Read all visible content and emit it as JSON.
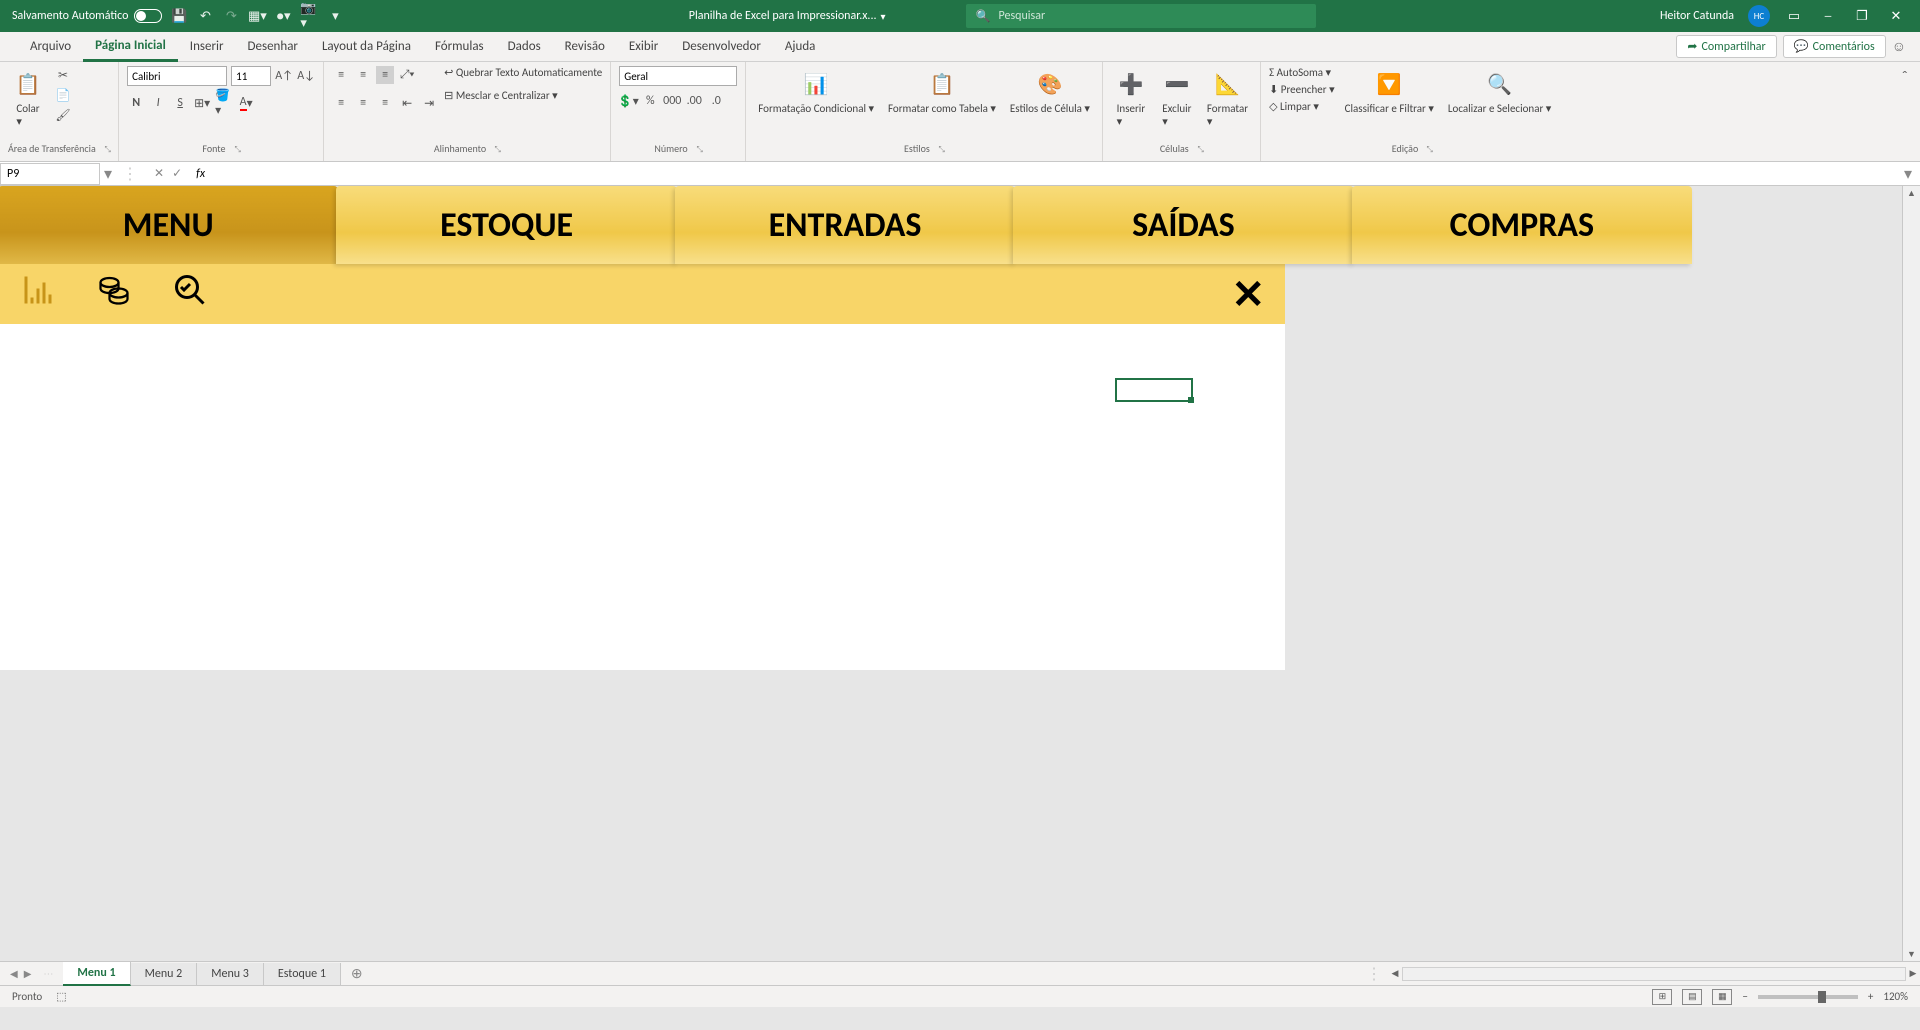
{
  "titleBar": {
    "autosave": "Salvamento Automático",
    "filename": "Planilha de Excel para Impressionar.x...",
    "searchPlaceholder": "Pesquisar",
    "username": "Heitor Catunda",
    "userInitials": "HC"
  },
  "ribbonTabs": {
    "arquivo": "Arquivo",
    "paginaInicial": "Página Inicial",
    "inserir": "Inserir",
    "desenhar": "Desenhar",
    "layout": "Layout da Página",
    "formulas": "Fórmulas",
    "dados": "Dados",
    "revisao": "Revisão",
    "exibir": "Exibir",
    "desenvolvedor": "Desenvolvedor",
    "ajuda": "Ajuda",
    "compartilhar": "Compartilhar",
    "comentarios": "Comentários"
  },
  "ribbonGroups": {
    "clipboard": {
      "label": "Área de Transferência",
      "colar": "Colar"
    },
    "font": {
      "label": "Fonte",
      "name": "Calibri",
      "size": "11",
      "bold": "N",
      "italic": "I",
      "underline": "S"
    },
    "alignment": {
      "label": "Alinhamento",
      "wrap": "Quebrar Texto Automaticamente",
      "merge": "Mesclar e Centralizar"
    },
    "number": {
      "label": "Número",
      "format": "Geral"
    },
    "styles": {
      "label": "Estilos",
      "conditional": "Formatação Condicional",
      "table": "Formatar como Tabela",
      "cell": "Estilos de Célula"
    },
    "cells": {
      "label": "Células",
      "inserir": "Inserir",
      "excluir": "Excluir",
      "formatar": "Formatar"
    },
    "editing": {
      "label": "Edição",
      "autosoma": "AutoSoma",
      "preencher": "Preencher",
      "limpar": "Limpar",
      "sort": "Classificar e Filtrar",
      "find": "Localizar e Selecionar"
    }
  },
  "formulaBar": {
    "cellRef": "P9"
  },
  "navTabs": {
    "menu": "MENU",
    "estoque": "ESTOQUE",
    "entradas": "ENTRADAS",
    "saidas": "SAÍDAS",
    "compras": "COMPRAS"
  },
  "sheetTabs": [
    "Menu 1",
    "Menu 2",
    "Menu 3",
    "Estoque 1"
  ],
  "statusBar": {
    "ready": "Pronto",
    "zoom": "120%"
  }
}
